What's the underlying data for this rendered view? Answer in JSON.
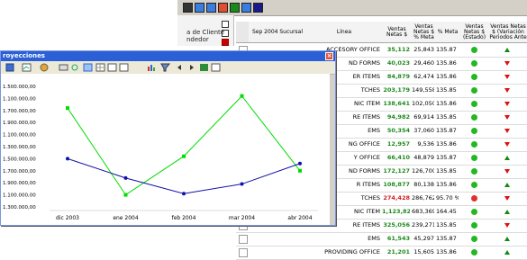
{
  "toolbar": {
    "icons": [
      "pointer-icon",
      "filter-icon",
      "funnel-icon",
      "sort-icon",
      "tree-icon",
      "pivot-icon",
      "grid-icon"
    ]
  },
  "fieldpane": {
    "line1": "a de Cliente",
    "line2": "ndedor"
  },
  "grid": {
    "headers": {
      "period": "Sep 2004 Sucursal",
      "line": "Línea",
      "sales": "Ventas Netas $",
      "goal": "Ventas Netas $ % Meta",
      "goal_pct": "% Meta",
      "status": "Ventas Netas $ (Estado)",
      "variation": "Ventas Netas $ (Variación Periodos Ante"
    },
    "rows": [
      {
        "line": "ACCESORY OFFICE",
        "sales": "35,112",
        "meta": "25,843",
        "pct": "135.87 %",
        "status": "green",
        "trend": "up"
      },
      {
        "line": "ND FORMS",
        "sales": "40,023",
        "meta": "29,460",
        "pct": "135.86 %",
        "status": "green",
        "trend": "down"
      },
      {
        "line": "ER ITEMS",
        "sales": "84,879",
        "meta": "62,474",
        "pct": "135.86 %",
        "status": "green",
        "trend": "down"
      },
      {
        "line": "TCHES",
        "sales": "203,179",
        "meta": "149,558",
        "pct": "135.85 %",
        "status": "green",
        "trend": "down"
      },
      {
        "line": "NIC ITEM",
        "sales": "138,641",
        "meta": "102,050",
        "pct": "135.86 %",
        "status": "green",
        "trend": "down"
      },
      {
        "line": "RE ITEMS",
        "sales": "94,982",
        "meta": "69,914",
        "pct": "135.85 %",
        "status": "green",
        "trend": "down"
      },
      {
        "line": "EMS",
        "sales": "50,354",
        "meta": "37,060",
        "pct": "135.87 %",
        "status": "green",
        "trend": "down"
      },
      {
        "line": "NG OFFICE",
        "sales": "12,957",
        "meta": "9,536",
        "pct": "135.86 %",
        "status": "green",
        "trend": "down"
      },
      {
        "line": "Y OFFICE",
        "sales": "66,410",
        "meta": "48,879",
        "pct": "135.87 %",
        "status": "green",
        "trend": "up"
      },
      {
        "line": "ND FORMS",
        "sales": "172,127",
        "meta": "126,700",
        "pct": "135.85 %",
        "status": "green",
        "trend": "down"
      },
      {
        "line": "R ITEMS",
        "sales": "108,877",
        "meta": "80,138",
        "pct": "135.86 %",
        "status": "green",
        "trend": "up"
      },
      {
        "line": "TCHES",
        "sales": "274,428",
        "meta": "286,762",
        "pct": "95.70 %",
        "status": "red",
        "trend": "down"
      },
      {
        "line": "NIC ITEM",
        "sales": "1,123,821",
        "meta": "683,369",
        "pct": "164.45 %",
        "status": "green",
        "trend": "up"
      },
      {
        "line": "RE ITEMS",
        "sales": "325,056",
        "meta": "239,271",
        "pct": "135.85 %",
        "status": "green",
        "trend": "down"
      },
      {
        "line": "EMS",
        "sales": "61,543",
        "meta": "45,297",
        "pct": "135.87 %",
        "status": "green",
        "trend": "up"
      },
      {
        "line": "PROVIDING OFFICE",
        "sales": "21,201",
        "meta": "15,605",
        "pct": "135.86 %",
        "status": "green",
        "trend": "up"
      }
    ]
  },
  "window": {
    "title": "royecciones",
    "close": "×"
  },
  "chart_data": {
    "type": "line",
    "categories": [
      "dic 2003",
      "ene 2004",
      "feb 2004",
      "mar 2004",
      "abr 2004"
    ],
    "ylim": [
      1300000,
      1500000
    ],
    "yticks": [
      "1.500.000,00",
      "1.100.000,00",
      "1.700.000,00",
      "1.900.000,00",
      "1.100.000,00",
      "1.300.000,00",
      "1.500.000,00",
      "1.700.000,00",
      "1.900.000,00",
      "1.100.000,00",
      "1.300.000,00"
    ],
    "series": [
      {
        "color": "#00dd00",
        "values": [
          0.82,
          0.1,
          0.42,
          0.92,
          0.3
        ]
      },
      {
        "color": "#1010aa",
        "values": [
          0.4,
          0.24,
          0.11,
          0.19,
          0.36
        ]
      }
    ]
  },
  "colors": {
    "green": "#22b822",
    "red": "#e03030",
    "triangle_up": "#108a10",
    "triangle_down": "#dd1010"
  }
}
